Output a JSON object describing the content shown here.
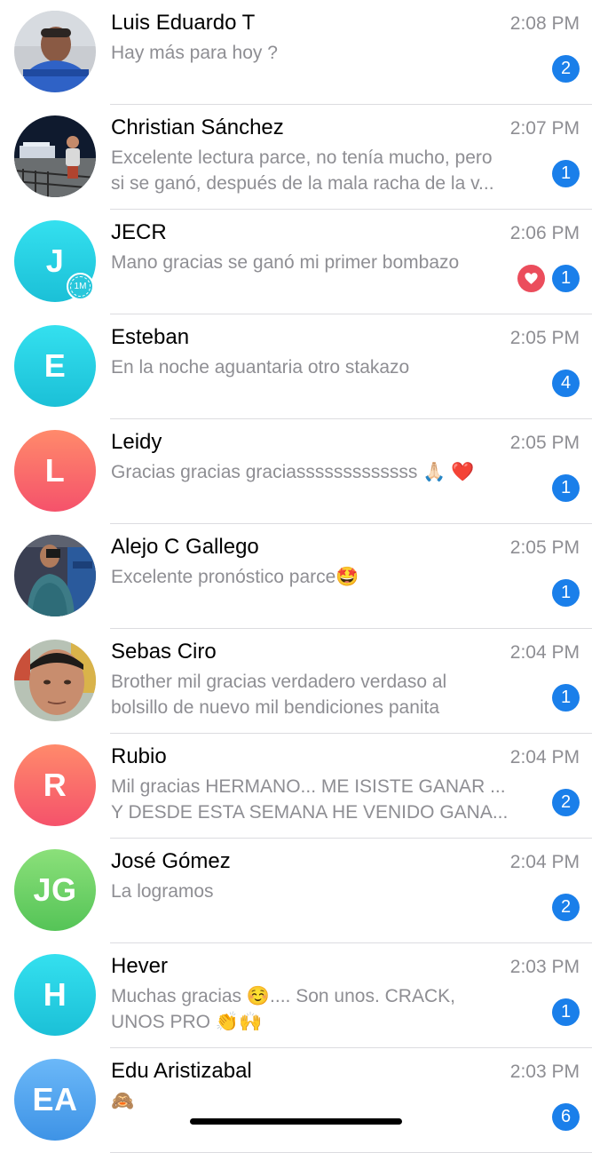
{
  "colors": {
    "badge": "#1a7fea",
    "divider": "#dcdce0",
    "name_text": "#000000",
    "secondary_text": "#8e8e93",
    "reaction": "#eb4d5c"
  },
  "chats": [
    {
      "name": "Luis Eduardo T",
      "time": "2:08 PM",
      "preview": [
        "Hay más para hoy ?"
      ],
      "unread": "2",
      "avatar": {
        "type": "photo",
        "icon": "person-photo-blue-shirt"
      }
    },
    {
      "name": "Christian Sánchez",
      "time": "2:07 PM",
      "preview": [
        "Excelente lectura parce, no tenía mucho, pero",
        "si se ganó, después de la mala racha de la v..."
      ],
      "unread": "1",
      "avatar": {
        "type": "photo",
        "icon": "person-photo-night-bridge"
      }
    },
    {
      "name": "JECR",
      "time": "2:06 PM",
      "preview": [
        "Mano gracias se ganó mi primer bombazo"
      ],
      "unread": "1",
      "reaction": "heart-icon",
      "avatar": {
        "type": "initials",
        "initials": "J",
        "color_top": "#34e0ef",
        "color_bottom": "#1bc0d7",
        "story_label": "1M"
      }
    },
    {
      "name": "Esteban",
      "time": "2:05 PM",
      "preview": [
        "En la noche aguantaria otro stakazo"
      ],
      "unread": "4",
      "avatar": {
        "type": "initials",
        "initials": "E",
        "color_top": "#34e0ef",
        "color_bottom": "#1bc0d7"
      }
    },
    {
      "name": "Leidy",
      "time": "2:05 PM",
      "preview": [
        "Gracias gracias graciasssssssssssss 🙏🏻 ❤️"
      ],
      "unread": "1",
      "avatar": {
        "type": "initials",
        "initials": "L",
        "color_top": "#ff8a6b",
        "color_bottom": "#f5526b"
      }
    },
    {
      "name": "Alejo C Gallego",
      "time": "2:05 PM",
      "preview": [
        "Excelente pronóstico parce🤩"
      ],
      "unread": "1",
      "avatar": {
        "type": "photo",
        "icon": "person-photo-gym-mirror"
      }
    },
    {
      "name": "Sebas Ciro",
      "time": "2:04 PM",
      "preview": [
        "Brother mil gracias verdadero verdaso al",
        "bolsillo de nuevo mil bendiciones panita"
      ],
      "unread": "1",
      "avatar": {
        "type": "photo",
        "icon": "person-photo-selfie"
      }
    },
    {
      "name": "Rubio",
      "time": "2:04 PM",
      "preview": [
        "Mil gracias HERMANO... ME ISISTE GANAR ...",
        "Y DESDE ESTA SEMANA HE VENIDO GANA..."
      ],
      "unread": "2",
      "avatar": {
        "type": "initials",
        "initials": "R",
        "color_top": "#ff8a6b",
        "color_bottom": "#f5526b"
      }
    },
    {
      "name": "José Gómez",
      "time": "2:04 PM",
      "preview": [
        "La logramos"
      ],
      "unread": "2",
      "avatar": {
        "type": "initials",
        "initials": "JG",
        "color_top": "#8be07a",
        "color_bottom": "#55c457"
      }
    },
    {
      "name": "Hever",
      "time": "2:03 PM",
      "preview": [
        "Muchas gracias ☺️.... Son unos. CRACK,",
        "UNOS PRO 👏🙌"
      ],
      "unread": "1",
      "avatar": {
        "type": "initials",
        "initials": "H",
        "color_top": "#34e0ef",
        "color_bottom": "#1bc0d7"
      }
    },
    {
      "name": "Edu Aristizabal",
      "time": "2:03 PM",
      "preview": [
        "🙈"
      ],
      "unread": "6",
      "avatar": {
        "type": "initials",
        "initials": "EA",
        "color_top": "#6bb8f8",
        "color_bottom": "#3e93e6"
      }
    }
  ]
}
